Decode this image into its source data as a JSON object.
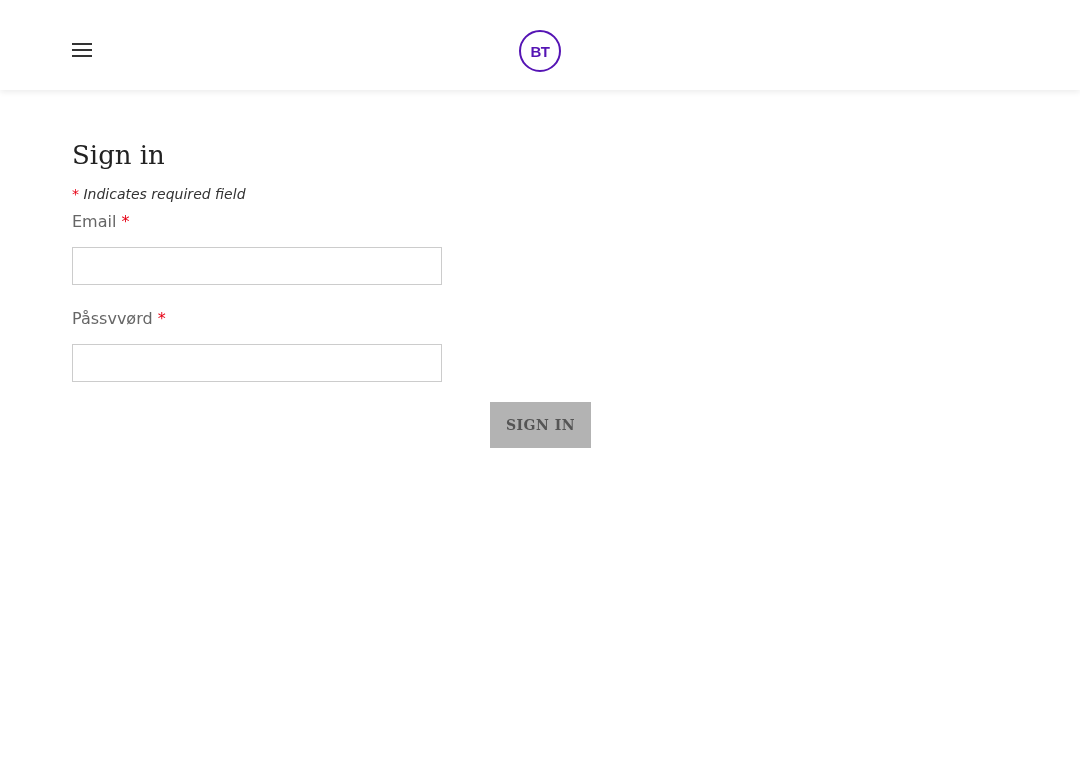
{
  "header": {
    "logo": "BT"
  },
  "title": "Sign in",
  "required_note": {
    "mark": "*",
    "text": "Indicates required field"
  },
  "fields": [
    {
      "label": "Email",
      "required_mark": "*"
    },
    {
      "label": "Påssvvørd",
      "required_mark": "*"
    }
  ],
  "submit": {
    "label": "SIGN IN",
    "disabled": true
  }
}
